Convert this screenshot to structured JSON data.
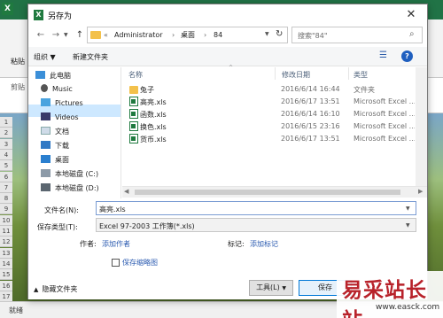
{
  "background": {
    "ribbon_paste": "粘贴",
    "ribbon_clipboard": "剪贴",
    "row_numbers": [
      "1",
      "2",
      "3",
      "4",
      "5",
      "6",
      "7",
      "8",
      "9",
      "10",
      "11",
      "12",
      "13",
      "14",
      "15",
      "16",
      "17"
    ],
    "status_ready": "就绪"
  },
  "watermark": {
    "text": "易采站长站",
    "url": "www.easck.com"
  },
  "dialog": {
    "title": "另存为",
    "address": {
      "prefix": "«",
      "segments": [
        "Administrator",
        "桌面",
        "84"
      ]
    },
    "search_placeholder": "搜索\"84\"",
    "toolbar": {
      "organize": "组织 ▼",
      "new_folder": "新建文件夹"
    },
    "sidebar": [
      {
        "label": "此电脑",
        "icon": "computer-icon"
      },
      {
        "label": "Music",
        "icon": "music-icon"
      },
      {
        "label": "Pictures",
        "icon": "pictures-icon"
      },
      {
        "label": "Videos",
        "icon": "videos-icon"
      },
      {
        "label": "文档",
        "icon": "documents-icon"
      },
      {
        "label": "下载",
        "icon": "download-icon"
      },
      {
        "label": "桌面",
        "icon": "desktop-icon"
      },
      {
        "label": "本地磁盘 (C:)",
        "icon": "drive-icon"
      },
      {
        "label": "本地磁盘 (D:)",
        "icon": "drive-icon"
      }
    ],
    "columns": {
      "name": "名称",
      "modified": "修改日期",
      "type": "类型"
    },
    "files": [
      {
        "name": "兔子",
        "date": "2016/6/14 16:44",
        "type": "文件夹",
        "kind": "folder"
      },
      {
        "name": "高亮.xls",
        "date": "2016/6/17 13:51",
        "type": "Microsoft Excel ...",
        "kind": "xls"
      },
      {
        "name": "函数.xls",
        "date": "2016/6/14 16:10",
        "type": "Microsoft Excel ...",
        "kind": "xls"
      },
      {
        "name": "换色.xls",
        "date": "2016/6/15 23:16",
        "type": "Microsoft Excel ...",
        "kind": "xls"
      },
      {
        "name": "货币.xls",
        "date": "2016/6/17 13:51",
        "type": "Microsoft Excel ...",
        "kind": "xls"
      }
    ],
    "filename_label": "文件名(N):",
    "filename_value": "高亮.xls",
    "savetype_label": "保存类型(T):",
    "savetype_value": "Excel 97-2003 工作簿(*.xls)",
    "author_label": "作者:",
    "author_link": "添加作者",
    "tags_label": "标记:",
    "tags_link": "添加标记",
    "thumbnail_label": "保存缩略图",
    "hide_folders": "隐藏文件夹",
    "tools_button": "工具(L)",
    "save_button": "保存"
  }
}
